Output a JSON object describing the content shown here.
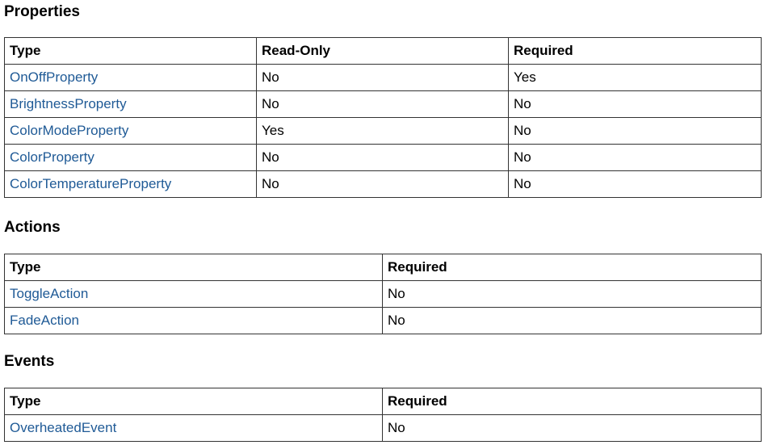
{
  "properties": {
    "title": "Properties",
    "headers": [
      "Type",
      "Read-Only",
      "Required"
    ],
    "rows": [
      {
        "type": "OnOffProperty",
        "read_only": "No",
        "required": "Yes"
      },
      {
        "type": "BrightnessProperty",
        "read_only": "No",
        "required": "No"
      },
      {
        "type": "ColorModeProperty",
        "read_only": "Yes",
        "required": "No"
      },
      {
        "type": "ColorProperty",
        "read_only": "No",
        "required": "No"
      },
      {
        "type": "ColorTemperatureProperty",
        "read_only": "No",
        "required": "No"
      }
    ]
  },
  "actions": {
    "title": "Actions",
    "headers": [
      "Type",
      "Required"
    ],
    "rows": [
      {
        "type": "ToggleAction",
        "required": "No"
      },
      {
        "type": "FadeAction",
        "required": "No"
      }
    ]
  },
  "events": {
    "title": "Events",
    "headers": [
      "Type",
      "Required"
    ],
    "rows": [
      {
        "type": "OverheatedEvent",
        "required": "No"
      }
    ]
  },
  "colors": {
    "link": "#1f5a96",
    "border": "#333333",
    "text": "#000000"
  }
}
